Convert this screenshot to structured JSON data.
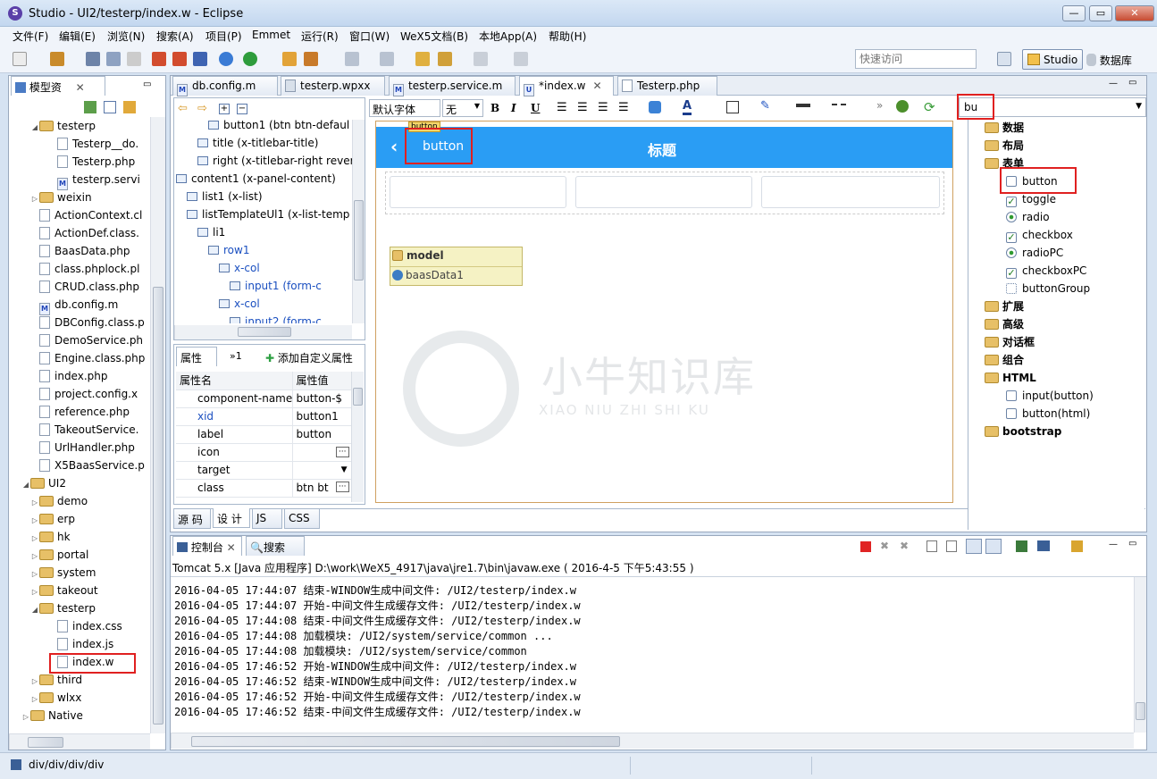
{
  "window": {
    "title": "Studio - UI2/testerp/index.w - Eclipse",
    "min": "—",
    "max": "▭",
    "close": "✕"
  },
  "menu": [
    "文件(F)",
    "编辑(E)",
    "浏览(N)",
    "搜索(A)",
    "项目(P)",
    "Emmet",
    "运行(R)",
    "窗口(W)",
    "WeX5文档(B)",
    "本地App(A)",
    "帮助(H)"
  ],
  "toolbar": {
    "quick_access_placeholder": "快速访问",
    "studio": "Studio",
    "database": "数据库"
  },
  "left_panel": {
    "tab": "模型资",
    "tree": [
      {
        "label": "testerp",
        "type": "folder",
        "indent": 2,
        "open": true
      },
      {
        "label": "Testerp__do.",
        "type": "file",
        "indent": 4
      },
      {
        "label": "Testerp.php",
        "type": "file",
        "indent": 4
      },
      {
        "label": "testerp.servi",
        "type": "m",
        "indent": 4
      },
      {
        "label": "weixin",
        "type": "folder",
        "indent": 2,
        "open": false
      },
      {
        "label": "ActionContext.cl",
        "type": "file",
        "indent": 2
      },
      {
        "label": "ActionDef.class.",
        "type": "file",
        "indent": 2
      },
      {
        "label": "BaasData.php",
        "type": "file",
        "indent": 2
      },
      {
        "label": "class.phplock.pl",
        "type": "file",
        "indent": 2
      },
      {
        "label": "CRUD.class.php",
        "type": "file",
        "indent": 2
      },
      {
        "label": "db.config.m",
        "type": "m",
        "indent": 2
      },
      {
        "label": "DBConfig.class.p",
        "type": "file",
        "indent": 2
      },
      {
        "label": "DemoService.ph",
        "type": "file",
        "indent": 2
      },
      {
        "label": "Engine.class.php",
        "type": "file",
        "indent": 2
      },
      {
        "label": "index.php",
        "type": "file",
        "indent": 2
      },
      {
        "label": "project.config.x",
        "type": "file",
        "indent": 2
      },
      {
        "label": "reference.php",
        "type": "file",
        "indent": 2
      },
      {
        "label": "TakeoutService.",
        "type": "file",
        "indent": 2
      },
      {
        "label": "UrlHandler.php",
        "type": "file",
        "indent": 2
      },
      {
        "label": "X5BaasService.p",
        "type": "file",
        "indent": 2
      },
      {
        "label": "UI2",
        "type": "folder",
        "indent": 1,
        "open": true
      },
      {
        "label": "demo",
        "type": "folder",
        "indent": 2,
        "open": false
      },
      {
        "label": "erp",
        "type": "folder",
        "indent": 2,
        "open": false
      },
      {
        "label": "hk",
        "type": "folder",
        "indent": 2,
        "open": false
      },
      {
        "label": "portal",
        "type": "folder",
        "indent": 2,
        "open": false
      },
      {
        "label": "system",
        "type": "folder",
        "indent": 2,
        "open": false
      },
      {
        "label": "takeout",
        "type": "folder",
        "indent": 2,
        "open": false
      },
      {
        "label": "testerp",
        "type": "folder",
        "indent": 2,
        "open": true
      },
      {
        "label": "index.css",
        "type": "file",
        "indent": 4
      },
      {
        "label": "index.js",
        "type": "file",
        "indent": 4
      },
      {
        "label": "index.w",
        "type": "file",
        "indent": 4
      },
      {
        "label": "third",
        "type": "folder",
        "indent": 2,
        "open": false
      },
      {
        "label": "wlxx",
        "type": "folder",
        "indent": 2,
        "open": false
      },
      {
        "label": "Native",
        "type": "folder",
        "indent": 1,
        "open": false
      }
    ]
  },
  "editor_tabs": [
    "db.config.m",
    "testerp.wpxx",
    "testerp.service.m",
    "*index.w",
    "Testerp.php"
  ],
  "outline": [
    {
      "label": "button1 (btn btn-defaul",
      "indent": 3
    },
    {
      "label": "title (x-titlebar-title)",
      "indent": 2
    },
    {
      "label": "right (x-titlebar-right revers",
      "indent": 2
    },
    {
      "label": "content1 (x-panel-content)",
      "indent": 0
    },
    {
      "label": "list1 (x-list)",
      "indent": 1
    },
    {
      "label": "listTemplateUl1 (x-list-temp",
      "indent": 1
    },
    {
      "label": "li1",
      "indent": 2
    },
    {
      "label": "row1",
      "indent": 3
    },
    {
      "label": "x-col",
      "indent": 4
    },
    {
      "label": "input1 (form-c",
      "indent": 5
    },
    {
      "label": "x-col",
      "indent": 4
    },
    {
      "label": "input2 (form-c",
      "indent": 5
    }
  ],
  "props": {
    "tab1": "属性",
    "tab2": "1",
    "add_custom": "添加自定义属性",
    "col_name": "属性名",
    "col_value": "属性值",
    "rows": [
      {
        "name": "component-name",
        "value": "button-$"
      },
      {
        "name": "xid",
        "value": "button1"
      },
      {
        "name": "label",
        "value": "button"
      },
      {
        "name": "icon",
        "value": ""
      },
      {
        "name": "target",
        "value": ""
      },
      {
        "name": "class",
        "value": "btn bt"
      }
    ]
  },
  "design": {
    "font_select": "默认字体",
    "size_select": "无",
    "titlebar_title": "标题",
    "button_label": "button",
    "button_tag": "button",
    "model_label": "model",
    "model_item": "baasData1",
    "watermark_cn": "小牛知识库",
    "watermark_en": "XIAO NIU ZHI SHI KU",
    "bottom_tabs": [
      "源 码",
      "设 计",
      "JS",
      "CSS"
    ]
  },
  "palette": {
    "search": "bu",
    "items": [
      {
        "label": "数据",
        "kind": "folder"
      },
      {
        "label": "布局",
        "kind": "folder"
      },
      {
        "label": "表单",
        "kind": "folder"
      },
      {
        "label": "button",
        "kind": "box"
      },
      {
        "label": "toggle",
        "kind": "check"
      },
      {
        "label": "radio",
        "kind": "radio"
      },
      {
        "label": "checkbox",
        "kind": "check"
      },
      {
        "label": "radioPC",
        "kind": "radio"
      },
      {
        "label": "checkboxPC",
        "kind": "check"
      },
      {
        "label": "buttonGroup",
        "kind": "grid"
      },
      {
        "label": "扩展",
        "kind": "folder"
      },
      {
        "label": "高级",
        "kind": "folder"
      },
      {
        "label": "对话框",
        "kind": "folder"
      },
      {
        "label": "组合",
        "kind": "folder"
      },
      {
        "label": "HTML",
        "kind": "folder"
      },
      {
        "label": "input(button)",
        "kind": "box"
      },
      {
        "label": "button(html)",
        "kind": "box"
      },
      {
        "label": "bootstrap",
        "kind": "folder"
      }
    ]
  },
  "console": {
    "tab1": "控制台",
    "tab2": "搜索",
    "header": "Tomcat 5.x [Java 应用程序] D:\\work\\WeX5_4917\\java\\jre1.7\\bin\\javaw.exe ( 2016-4-5 下午5:43:55 )",
    "lines": [
      "2016-04-05 17:44:07 结束-WINDOW生成中间文件: /UI2/testerp/index.w",
      "2016-04-05 17:44:07 开始-中间文件生成缓存文件: /UI2/testerp/index.w",
      "2016-04-05 17:44:08 结束-中间文件生成缓存文件: /UI2/testerp/index.w",
      "2016-04-05 17:44:08 加载模块: /UI2/system/service/common ...",
      "2016-04-05 17:44:08 加载模块: /UI2/system/service/common",
      "2016-04-05 17:46:52 开始-WINDOW生成中间文件: /UI2/testerp/index.w",
      "2016-04-05 17:46:52 结束-WINDOW生成中间文件: /UI2/testerp/index.w",
      "2016-04-05 17:46:52 开始-中间文件生成缓存文件: /UI2/testerp/index.w",
      "2016-04-05 17:46:52 结束-中间文件生成缓存文件: /UI2/testerp/index.w"
    ]
  },
  "statusbar": "div/div/div/div",
  "colors": {
    "titlebar": "#2a9df4",
    "highlight": "#e02020",
    "accent": "#1a5fb4"
  }
}
